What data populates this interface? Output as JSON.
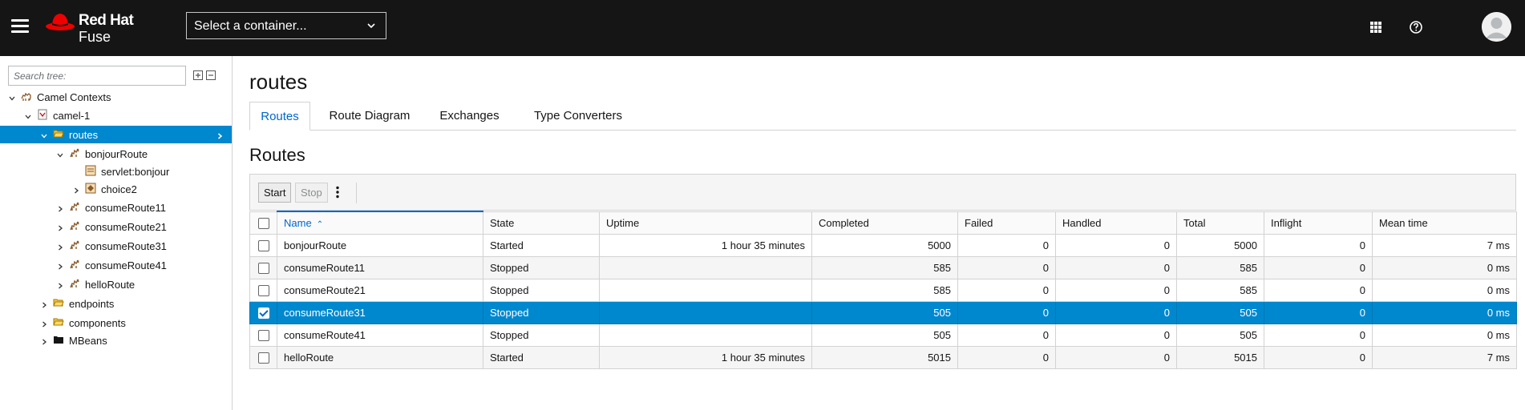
{
  "brand": {
    "name": "Red Hat",
    "product": "Fuse",
    "logo_icon": "red-hat-logo"
  },
  "masthead": {
    "container_select": "Select a container...",
    "icons": [
      "hamburger-menu-icon",
      "grid-icon",
      "help-icon",
      "user-avatar-icon"
    ]
  },
  "sidebar": {
    "search_placeholder": "Search tree:",
    "tree": [
      {
        "label": "Camel Contexts",
        "icon": "camel-icon",
        "expanded": true
      },
      {
        "label": "camel-1",
        "icon": "context-icon",
        "expanded": true
      },
      {
        "label": "routes",
        "icon": "folder-open-icon",
        "expanded": true,
        "selected": true
      },
      {
        "label": "bonjourRoute",
        "icon": "route-icon",
        "expanded": true
      },
      {
        "label": "servlet:bonjour",
        "icon": "endpoint-icon"
      },
      {
        "label": "choice2",
        "icon": "choice-icon",
        "expanded": false
      },
      {
        "label": "consumeRoute11",
        "icon": "route-icon",
        "expanded": false
      },
      {
        "label": "consumeRoute21",
        "icon": "route-icon",
        "expanded": false
      },
      {
        "label": "consumeRoute31",
        "icon": "route-icon",
        "expanded": false
      },
      {
        "label": "consumeRoute41",
        "icon": "route-icon",
        "expanded": false
      },
      {
        "label": "helloRoute",
        "icon": "route-icon",
        "expanded": false
      },
      {
        "label": "endpoints",
        "icon": "folder-open-icon",
        "expanded": false
      },
      {
        "label": "components",
        "icon": "folder-open-icon",
        "expanded": false
      },
      {
        "label": "MBeans",
        "icon": "folder-icon",
        "expanded": false
      }
    ]
  },
  "main": {
    "title": "routes",
    "tabs": [
      "Routes",
      "Route Diagram",
      "Exchanges",
      "Type Converters"
    ],
    "active_tab": "Routes",
    "section_title": "Routes",
    "toolbar": {
      "start": "Start",
      "stop": "Stop"
    },
    "table": {
      "columns": [
        "Name",
        "State",
        "Uptime",
        "Completed",
        "Failed",
        "Handled",
        "Total",
        "Inflight",
        "Mean time"
      ],
      "sorted_column": "Name",
      "rows": [
        {
          "name": "bonjourRoute",
          "state": "Started",
          "uptime": "1 hour 35 minutes",
          "completed": "5000",
          "failed": "0",
          "handled": "0",
          "total": "5000",
          "inflight": "0",
          "mean": "7 ms",
          "checked": false
        },
        {
          "name": "consumeRoute11",
          "state": "Stopped",
          "uptime": "",
          "completed": "585",
          "failed": "0",
          "handled": "0",
          "total": "585",
          "inflight": "0",
          "mean": "0 ms",
          "checked": false
        },
        {
          "name": "consumeRoute21",
          "state": "Stopped",
          "uptime": "",
          "completed": "585",
          "failed": "0",
          "handled": "0",
          "total": "585",
          "inflight": "0",
          "mean": "0 ms",
          "checked": false
        },
        {
          "name": "consumeRoute31",
          "state": "Stopped",
          "uptime": "",
          "completed": "505",
          "failed": "0",
          "handled": "0",
          "total": "505",
          "inflight": "0",
          "mean": "0 ms",
          "checked": true
        },
        {
          "name": "consumeRoute41",
          "state": "Stopped",
          "uptime": "",
          "completed": "505",
          "failed": "0",
          "handled": "0",
          "total": "505",
          "inflight": "0",
          "mean": "0 ms",
          "checked": false
        },
        {
          "name": "helloRoute",
          "state": "Started",
          "uptime": "1 hour 35 minutes",
          "completed": "5015",
          "failed": "0",
          "handled": "0",
          "total": "5015",
          "inflight": "0",
          "mean": "7 ms",
          "checked": false
        }
      ]
    }
  },
  "colors": {
    "masthead": "#151515",
    "accent": "#0088ce",
    "link": "#0066cc",
    "brand_red": "#ee0000"
  }
}
